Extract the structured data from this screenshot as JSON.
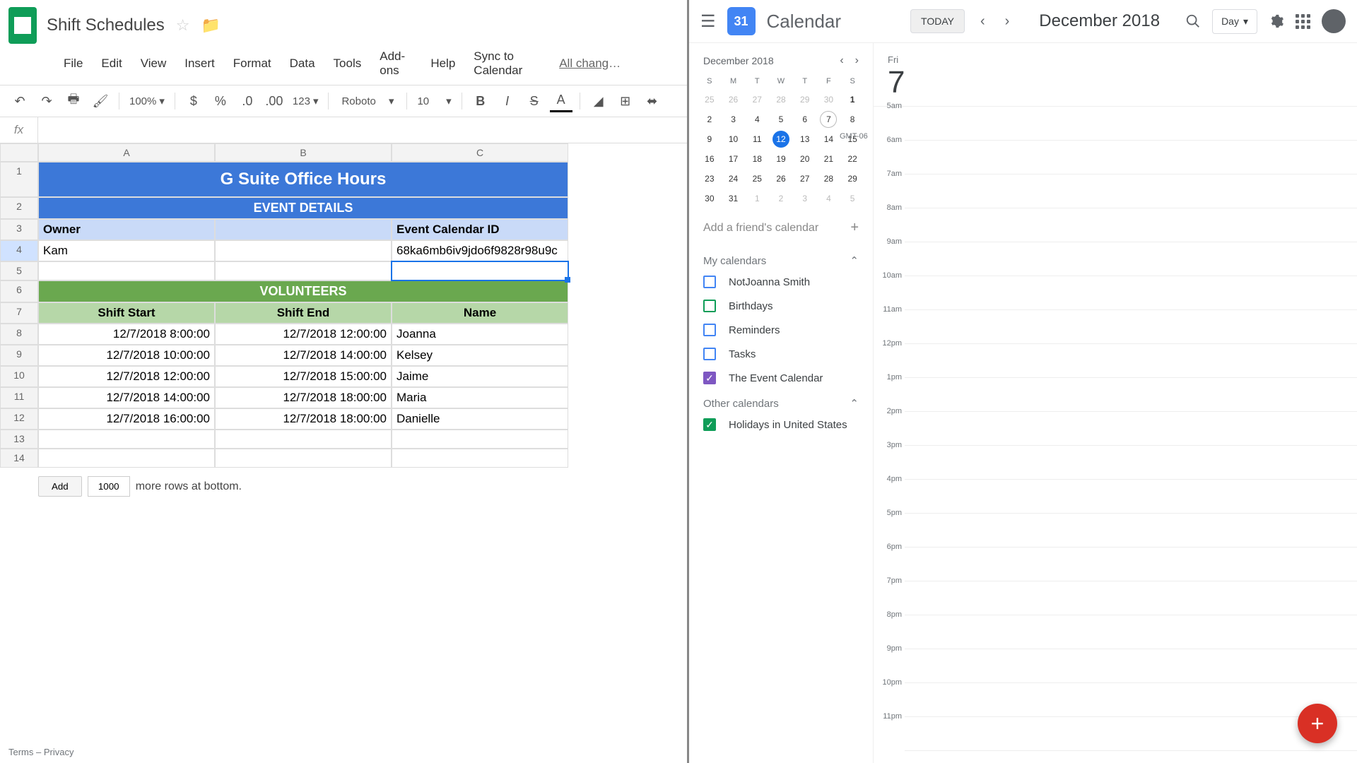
{
  "sheets": {
    "doc_title": "Shift Schedules",
    "menu": [
      "File",
      "Edit",
      "View",
      "Insert",
      "Format",
      "Data",
      "Tools",
      "Add-ons",
      "Help",
      "Sync to Calendar"
    ],
    "saved_msg": "All changes sa...",
    "zoom": "100%",
    "font_name": "Roboto",
    "font_size": "10",
    "num_fmt": "123",
    "columns": [
      "A",
      "B",
      "C"
    ],
    "title": "G Suite Office Hours",
    "subtitle": "EVENT DETAILS",
    "owner_hdr": "Owner",
    "cal_id_hdr": "Event Calendar ID",
    "owner_val": "Kam",
    "cal_id_val": "68ka6mb6iv9jdo6f9828r98u9c",
    "vol_hdr": "VOLUNTEERS",
    "shift_start_hdr": "Shift Start",
    "shift_end_hdr": "Shift End",
    "name_hdr": "Name",
    "rows": [
      {
        "start": "12/7/2018 8:00:00",
        "end": "12/7/2018 12:00:00",
        "name": "Joanna"
      },
      {
        "start": "12/7/2018 10:00:00",
        "end": "12/7/2018 14:00:00",
        "name": "Kelsey"
      },
      {
        "start": "12/7/2018 12:00:00",
        "end": "12/7/2018 15:00:00",
        "name": "Jaime"
      },
      {
        "start": "12/7/2018 14:00:00",
        "end": "12/7/2018 18:00:00",
        "name": "Maria"
      },
      {
        "start": "12/7/2018 16:00:00",
        "end": "12/7/2018 18:00:00",
        "name": "Danielle"
      }
    ],
    "add_btn": "Add",
    "rows_count": "1000",
    "more_rows": "more rows at bottom.",
    "fx": "fx"
  },
  "calendar": {
    "logo_day": "31",
    "title": "Calendar",
    "today": "TODAY",
    "month": "December 2018",
    "view": "Day",
    "mini_month": "December 2018",
    "dow": [
      "S",
      "M",
      "T",
      "W",
      "T",
      "F",
      "S"
    ],
    "weeks": [
      [
        {
          "d": "25",
          "dim": true
        },
        {
          "d": "26",
          "dim": true
        },
        {
          "d": "27",
          "dim": true
        },
        {
          "d": "28",
          "dim": true
        },
        {
          "d": "29",
          "dim": true
        },
        {
          "d": "30",
          "dim": true
        },
        {
          "d": "1",
          "bold": true
        }
      ],
      [
        {
          "d": "2"
        },
        {
          "d": "3"
        },
        {
          "d": "4"
        },
        {
          "d": "5"
        },
        {
          "d": "6"
        },
        {
          "d": "7",
          "ring": true
        },
        {
          "d": "8"
        }
      ],
      [
        {
          "d": "9"
        },
        {
          "d": "10"
        },
        {
          "d": "11"
        },
        {
          "d": "12",
          "sel": true
        },
        {
          "d": "13"
        },
        {
          "d": "14"
        },
        {
          "d": "15"
        }
      ],
      [
        {
          "d": "16"
        },
        {
          "d": "17"
        },
        {
          "d": "18"
        },
        {
          "d": "19"
        },
        {
          "d": "20"
        },
        {
          "d": "21"
        },
        {
          "d": "22"
        }
      ],
      [
        {
          "d": "23"
        },
        {
          "d": "24"
        },
        {
          "d": "25"
        },
        {
          "d": "26"
        },
        {
          "d": "27"
        },
        {
          "d": "28"
        },
        {
          "d": "29"
        }
      ],
      [
        {
          "d": "30"
        },
        {
          "d": "31"
        },
        {
          "d": "1",
          "dim": true
        },
        {
          "d": "2",
          "dim": true
        },
        {
          "d": "3",
          "dim": true
        },
        {
          "d": "4",
          "dim": true
        },
        {
          "d": "5",
          "dim": true
        }
      ]
    ],
    "friend_placeholder": "Add a friend's calendar",
    "my_cals_hdr": "My calendars",
    "my_cals": [
      {
        "name": "NotJoanna Smith",
        "color": "#4285f4",
        "checked": false
      },
      {
        "name": "Birthdays",
        "color": "#0f9d58",
        "checked": false
      },
      {
        "name": "Reminders",
        "color": "#4285f4",
        "checked": false
      },
      {
        "name": "Tasks",
        "color": "#4285f4",
        "checked": false
      },
      {
        "name": "The Event Calendar",
        "color": "#7e57c2",
        "checked": true
      }
    ],
    "other_cals_hdr": "Other calendars",
    "other_cals": [
      {
        "name": "Holidays in United States",
        "color": "#0f9d58",
        "checked": true
      }
    ],
    "day_dow": "Fri",
    "day_num": "7",
    "tz": "GMT-06",
    "hours": [
      "5am",
      "6am",
      "7am",
      "8am",
      "9am",
      "10am",
      "11am",
      "12pm",
      "1pm",
      "2pm",
      "3pm",
      "4pm",
      "5pm",
      "6pm",
      "7pm",
      "8pm",
      "9pm",
      "10pm",
      "11pm"
    ],
    "terms": "Terms",
    "privacy": "Privacy"
  }
}
